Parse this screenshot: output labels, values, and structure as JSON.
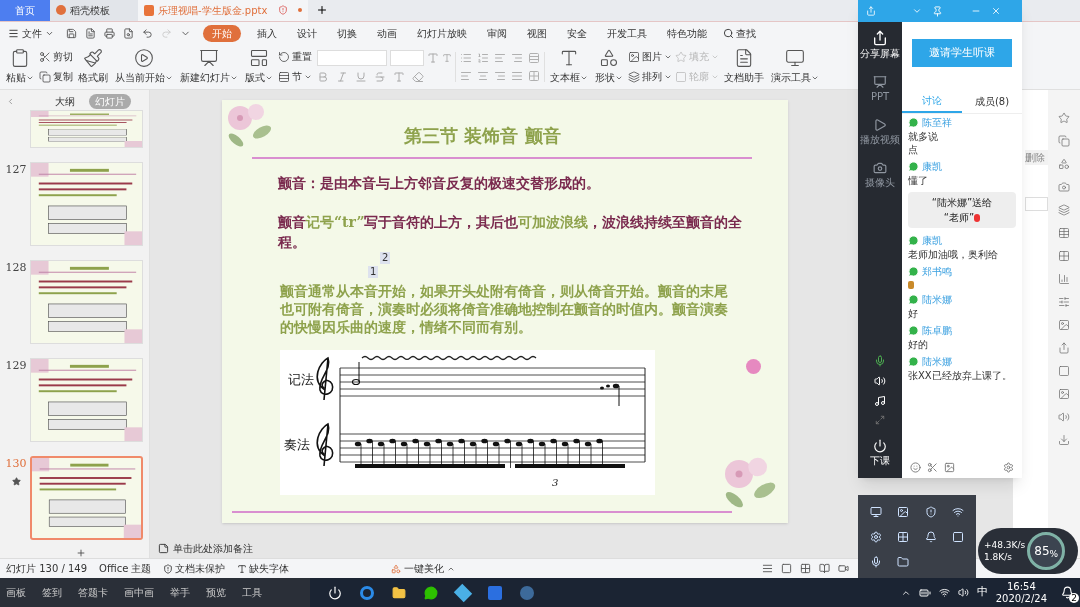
{
  "tabs": [
    {
      "label": "首页",
      "selected": false,
      "kind": "home"
    },
    {
      "label": "稻壳模板",
      "selected": false,
      "kind": "docer"
    },
    {
      "label": "乐理视唱-学生版金.pptx",
      "selected": true,
      "kind": "ppt"
    }
  ],
  "menu": {
    "file": "文件",
    "items": [
      {
        "label": "开始",
        "selected": true
      },
      {
        "label": "插入",
        "selected": false
      },
      {
        "label": "设计",
        "selected": false
      },
      {
        "label": "切换",
        "selected": false
      },
      {
        "label": "动画",
        "selected": false
      },
      {
        "label": "幻灯片放映",
        "selected": false
      },
      {
        "label": "审阅",
        "selected": false
      },
      {
        "label": "视图",
        "selected": false
      },
      {
        "label": "安全",
        "selected": false
      },
      {
        "label": "开发工具",
        "selected": false
      },
      {
        "label": "特色功能",
        "selected": false
      }
    ],
    "search": "查找"
  },
  "ribbon": [
    {
      "kind": "large",
      "label": "粘贴",
      "caret": true
    },
    {
      "kind": "stack",
      "items": [
        {
          "label": "剪切",
          "disabled": false,
          "caret": false
        },
        {
          "label": "复制",
          "disabled": false,
          "caret": false
        }
      ]
    },
    {
      "kind": "large",
      "label": "格式刷",
      "caret": false
    },
    {
      "kind": "large",
      "label": "从当前开始",
      "caret": true
    },
    {
      "kind": "large",
      "label": "新建幻灯片",
      "caret": true
    },
    {
      "kind": "large",
      "label": "版式",
      "caret": true
    },
    {
      "kind": "stack",
      "items": [
        {
          "label": "重置",
          "disabled": false,
          "caret": false
        },
        {
          "label": "节",
          "disabled": false,
          "caret": true
        }
      ]
    },
    {
      "kind": "font"
    },
    {
      "kind": "paragraph"
    },
    {
      "kind": "large",
      "label": "文本框",
      "caret": true
    },
    {
      "kind": "large",
      "label": "形状",
      "caret": true
    },
    {
      "kind": "stack",
      "items": [
        {
          "label": "图片",
          "disabled": false,
          "caret": true
        },
        {
          "label": "排列",
          "disabled": false,
          "caret": true
        }
      ]
    },
    {
      "kind": "stack",
      "items": [
        {
          "label": "填充",
          "disabled": true,
          "caret": true
        },
        {
          "label": "轮廓",
          "disabled": true,
          "caret": true
        }
      ]
    },
    {
      "kind": "large",
      "label": "文档助手",
      "caret": false
    },
    {
      "kind": "large",
      "label": "演示工具",
      "caret": true
    }
  ],
  "panel": {
    "tabs": [
      {
        "label": "大纲",
        "selected": false
      },
      {
        "label": "幻灯片",
        "selected": true
      }
    ],
    "slides": [
      {
        "selected": false,
        "starred": false
      },
      {
        "number": "127",
        "selected": false,
        "starred": false
      },
      {
        "number": "128",
        "selected": false,
        "starred": false
      },
      {
        "number": "129",
        "selected": false,
        "starred": false
      },
      {
        "number": "130",
        "selected": true,
        "starred": true
      }
    ]
  },
  "slide": {
    "title": "第三节 装饰音 颤音",
    "definition": "颤音：是由本音与上方邻音反复的极速交替形成的。",
    "notation": [
      {
        "text": "颤音",
        "color": "#7a2a4e"
      },
      {
        "text": "记号“tr”",
        "color": "#8ea24c"
      },
      {
        "text": "写于音符的上方，其后也",
        "color": "#7a2a4e"
      },
      {
        "text": "可加波浪线",
        "color": "#8ea24c"
      },
      {
        "text": "，波浪线持续至颤音的全程。",
        "color": "#7a2a4e"
      }
    ],
    "markers": [
      "2",
      "1"
    ],
    "description": "颤音通常从本音开始，如果开头处附有倚音，则从倚音开始。颤音的末尾也可附有倚音，演奏时必须将倚音准确地控制在颤音的时值内。颤音演奏的快慢因乐曲的速度，情绪不同而有别。",
    "score": {
      "labels": [
        "记法",
        "奏法"
      ],
      "triplet": "3"
    }
  },
  "notes_placeholder": "单击此处添加备注",
  "status": {
    "slide": "幻灯片 130 / 149",
    "theme": "Office 主题",
    "protect": "文档未保护",
    "font": "缺失字体",
    "beautify": "一键美化"
  },
  "wps_side": {
    "delete": "删除"
  },
  "chat": {
    "share": "分享屏幕",
    "side": [
      {
        "label": "PPT",
        "disabled": true
      },
      {
        "label": "播放视频",
        "disabled": true
      },
      {
        "label": "摄像头",
        "disabled": true
      }
    ],
    "end": "下课",
    "invite": "邀请学生听课",
    "tabs": [
      {
        "label": "讨论",
        "selected": true
      },
      {
        "label": "成员(8)",
        "selected": false
      }
    ],
    "messages": [
      {
        "kind": "message",
        "name": "陈至祥",
        "lines": [
          "就多说",
          "点"
        ]
      },
      {
        "kind": "message",
        "name": "康凯",
        "lines": [
          "懂了"
        ]
      },
      {
        "kind": "gift",
        "lines": [
          "“陆米娜”送给",
          "“老师”"
        ]
      },
      {
        "kind": "message",
        "name": "康凯",
        "lines": [
          "老师加油哦，奥利给"
        ]
      },
      {
        "kind": "sticker",
        "name": "郑书鸣"
      },
      {
        "kind": "message",
        "name": "陆米娜",
        "lines": [
          "好"
        ]
      },
      {
        "kind": "message",
        "name": "陈卓鹏",
        "lines": [
          "好的"
        ]
      },
      {
        "kind": "message",
        "name": "陆米娜",
        "lines": [
          "张XX已经放弃上课了。"
        ]
      }
    ]
  },
  "netspeed": {
    "up": "+48.3K/s",
    "down": "1.8K/s",
    "percent": "85$_{%}$"
  },
  "taskbar": {
    "tools": [
      "画板",
      "签到",
      "答题卡",
      "画中画",
      "举手",
      "预览",
      "工具"
    ],
    "ime": "中",
    "time": "16:54",
    "date": "2020/2/24",
    "notifications": "2"
  }
}
